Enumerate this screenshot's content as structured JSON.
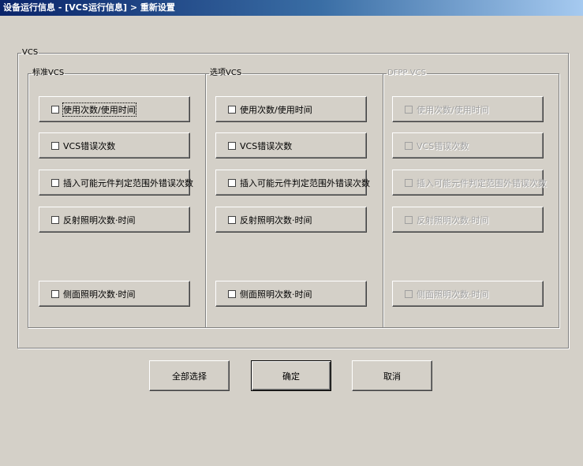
{
  "window": {
    "title": "设备运行信息 - [VCS运行信息] > 重新设置"
  },
  "group": {
    "legend": "VCS",
    "columns": [
      {
        "legend": "标准VCS",
        "disabled": false,
        "items": [
          {
            "label": "使用次数/使用时间",
            "checked": false,
            "focused": true
          },
          {
            "label": "VCS错误次数",
            "checked": false
          },
          {
            "label": "插入可能元件判定范围外错误次数",
            "checked": false
          },
          {
            "label": "反射照明次数·时间",
            "checked": false
          },
          {
            "label": "侧面照明次数·时间",
            "checked": false
          }
        ]
      },
      {
        "legend": "选项VCS",
        "disabled": false,
        "items": [
          {
            "label": "使用次数/使用时间",
            "checked": false
          },
          {
            "label": "VCS错误次数",
            "checked": false
          },
          {
            "label": "插入可能元件判定范围外错误次数",
            "checked": false
          },
          {
            "label": "反射照明次数·时间",
            "checked": false
          },
          {
            "label": "侧面照明次数·时间",
            "checked": false
          }
        ]
      },
      {
        "legend": "DFPP VCS",
        "disabled": true,
        "items": [
          {
            "label": "使用次数/使用时间",
            "checked": false
          },
          {
            "label": "VCS错误次数",
            "checked": false
          },
          {
            "label": "插入可能元件判定范围外错误次数",
            "checked": false
          },
          {
            "label": "反射照明次数·时间",
            "checked": false
          },
          {
            "label": "侧面照明次数·时间",
            "checked": false
          }
        ]
      }
    ]
  },
  "buttons": {
    "select_all": "全部选择",
    "ok": "确定",
    "cancel": "取消"
  }
}
